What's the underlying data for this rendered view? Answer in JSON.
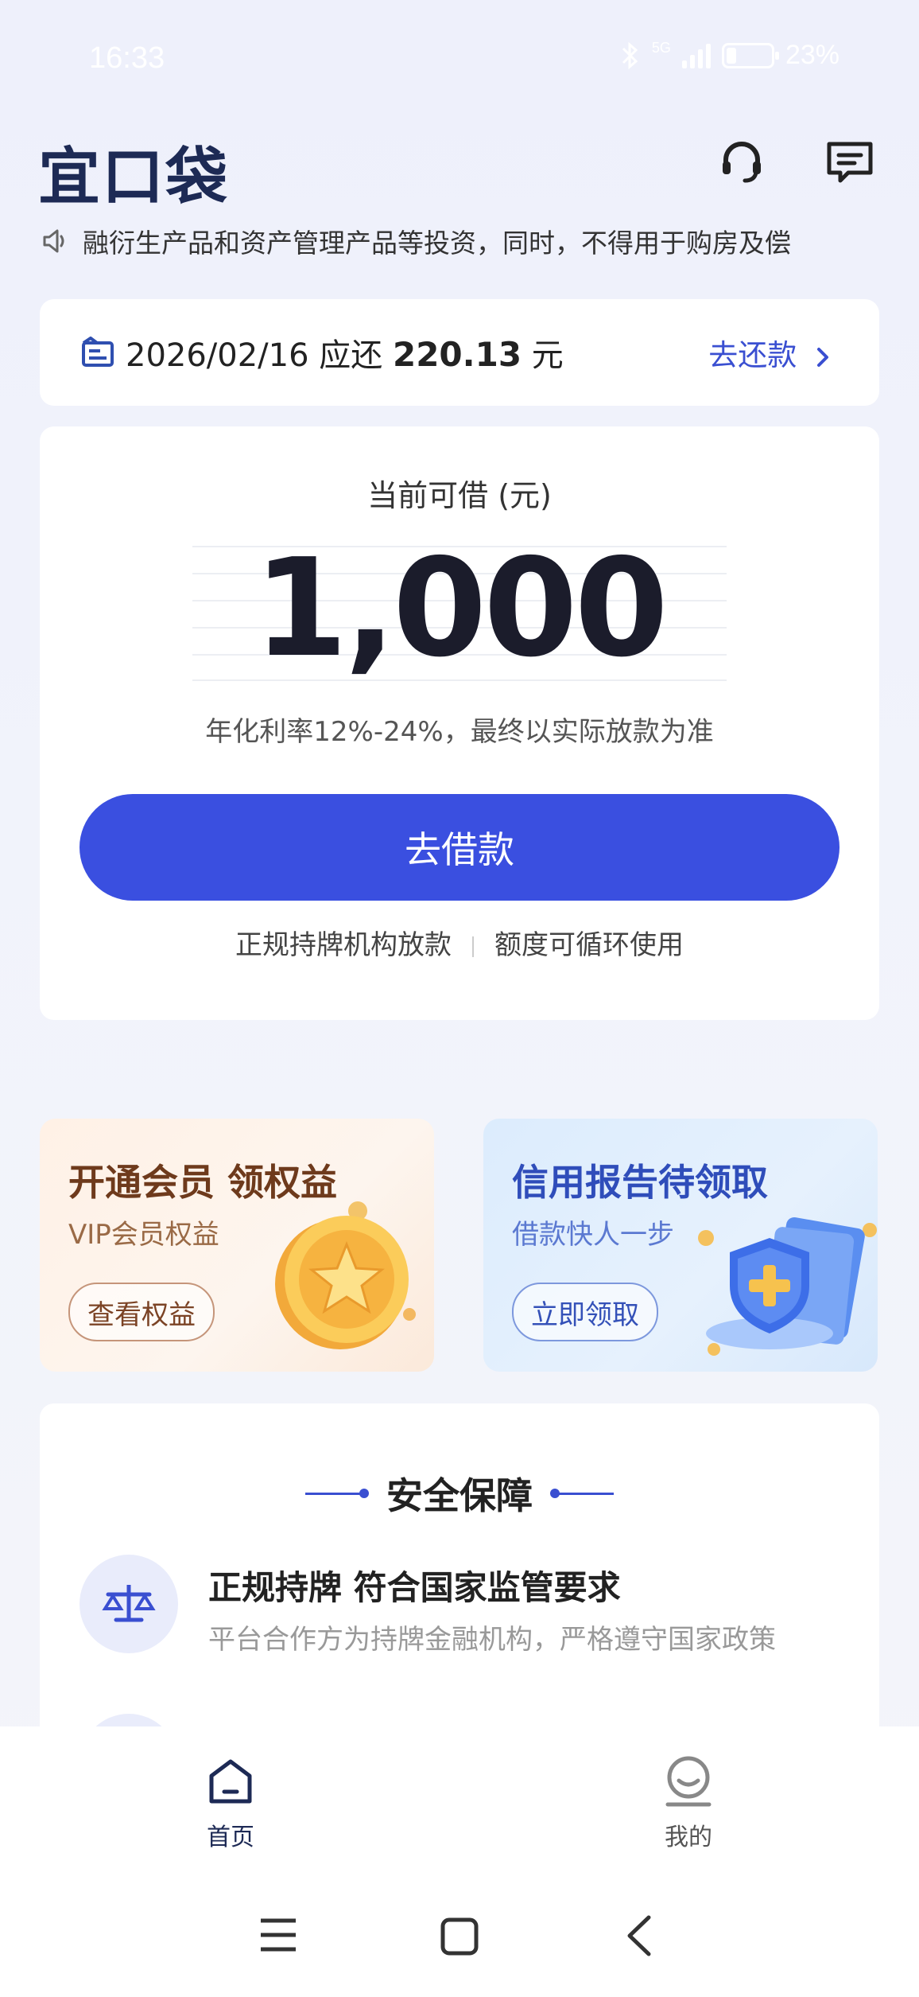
{
  "status_bar": {
    "time": "16:33",
    "network": "5G",
    "battery_percent": "23%",
    "battery_level": 0.23
  },
  "header": {
    "logo": "宜口袋",
    "icons": [
      "customer-service-icon",
      "message-icon"
    ]
  },
  "notice": {
    "icon": "speaker-icon",
    "text": "融衍生产品和资产管理产品等投资，同时，不得用于购房及偿"
  },
  "repayment": {
    "icon": "bill-icon",
    "date": "2026/02/16",
    "due_label": "应还",
    "amount": "220.13",
    "unit": "元",
    "action": "去还款"
  },
  "credit": {
    "label": "当前可借 (元)",
    "amount": "1,000",
    "rate_note": "年化利率12%-24%，最终以实际放款为准",
    "button": "去借款",
    "feature_1": "正规持牌机构放款",
    "feature_2": "额度可循环使用"
  },
  "promos": {
    "vip": {
      "title": "开通会员 领权益",
      "subtitle": "VIP会员权益",
      "button": "查看权益"
    },
    "credit_report": {
      "title": "信用报告待领取",
      "subtitle": "借款快人一步",
      "button": "立即领取"
    }
  },
  "safety": {
    "title": "安全保障",
    "items": [
      {
        "icon": "scale-icon",
        "title": "正规持牌 符合国家监管要求",
        "desc": "平台合作方为持牌金融机构，严格遵守国家政策"
      }
    ]
  },
  "tabbar": {
    "tabs": [
      {
        "label": "首页",
        "icon": "home-icon",
        "active": true
      },
      {
        "label": "我的",
        "icon": "profile-icon",
        "active": false
      }
    ]
  },
  "colors": {
    "primary": "#3a4fe0",
    "link": "#3a4fd1",
    "dark": "#1d2a55"
  }
}
